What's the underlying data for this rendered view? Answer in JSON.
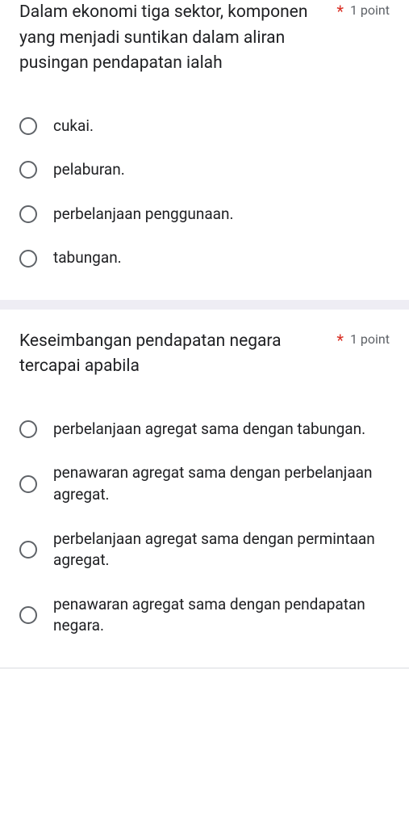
{
  "questions": [
    {
      "text": "Dalam ekonomi tiga sektor, komponen yang menjadi suntikan dalam aliran pusingan pendapatan ialah",
      "required_mark": "*",
      "points": "1 point",
      "options": [
        "cukai.",
        "pelaburan.",
        "perbelanjaan penggunaan.",
        "tabungan."
      ]
    },
    {
      "text": "Keseimbangan pendapatan negara tercapai apabila",
      "required_mark": "*",
      "points": "1 point",
      "options": [
        "perbelanjaan agregat sama dengan tabungan.",
        "penawaran agregat sama dengan perbelanjaan agregat.",
        "perbelanjaan agregat sama dengan permintaan agregat.",
        "penawaran agregat sama dengan pendapatan negara."
      ]
    }
  ]
}
